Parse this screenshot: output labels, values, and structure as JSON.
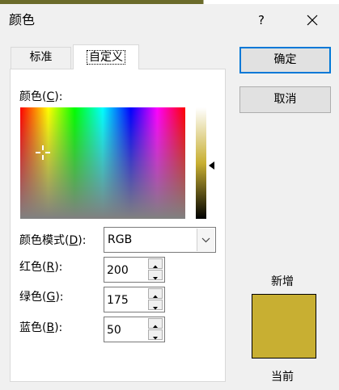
{
  "colors": {
    "current": "#c8af32",
    "accent": "#0078d7",
    "top_strip": "#4a4a1a"
  },
  "dialog": {
    "title": "颜色",
    "help_label": "?",
    "close_icon": "close-icon"
  },
  "tabs": [
    {
      "label": "标准"
    },
    {
      "label": "自定义"
    }
  ],
  "picker": {
    "color_label": "颜色(",
    "color_key": "C",
    "color_suffix": "):"
  },
  "mode": {
    "label": "颜色模式(",
    "key": "D",
    "suffix": "):",
    "value": "RGB"
  },
  "channels": [
    {
      "label": "红色(",
      "key": "R",
      "suffix": "):",
      "value": "200"
    },
    {
      "label": "绿色(",
      "key": "G",
      "suffix": "):",
      "value": "175"
    },
    {
      "label": "蓝色(",
      "key": "B",
      "suffix": "):",
      "value": "50"
    }
  ],
  "buttons": {
    "ok": "确定",
    "cancel": "取消"
  },
  "preview": {
    "new_label": "新增",
    "current_label": "当前"
  }
}
